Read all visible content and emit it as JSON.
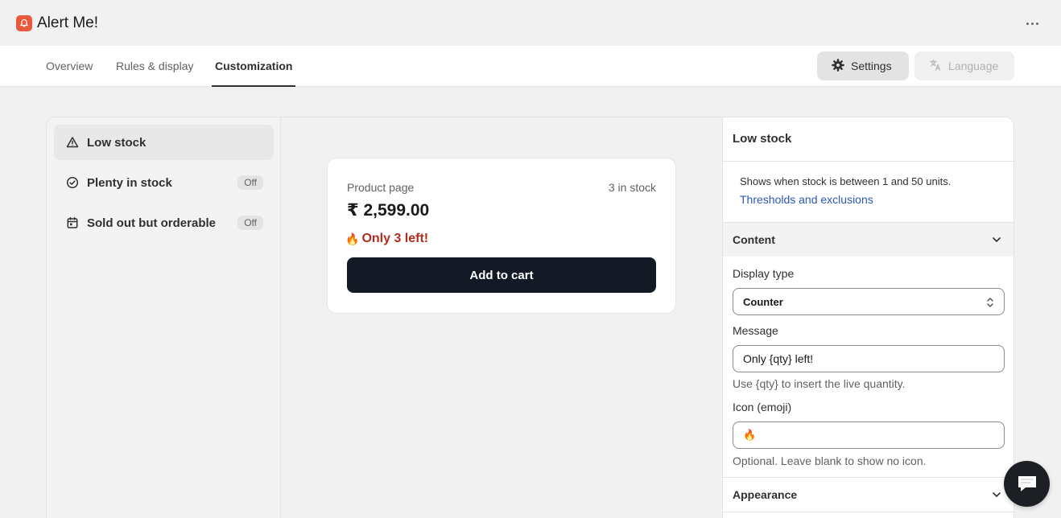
{
  "app": {
    "title": "Alert Me!",
    "accent_color": "#e8583a",
    "logo_icon": "bell-icon",
    "more_icon": "more-horizontal-icon"
  },
  "tabs": [
    {
      "label": "Overview",
      "active": false
    },
    {
      "label": "Rules & display",
      "active": false
    },
    {
      "label": "Customization",
      "active": true
    }
  ],
  "header_actions": {
    "settings_label": "Settings",
    "settings_icon": "gear-icon",
    "language_label": "Language",
    "language_icon": "translate-icon",
    "language_disabled": true
  },
  "alert_types": [
    {
      "label": "Low stock",
      "icon": "warning-triangle-icon",
      "active": true,
      "badge": ""
    },
    {
      "label": "Plenty in stock",
      "icon": "check-circle-icon",
      "active": false,
      "badge": "Off"
    },
    {
      "label": "Sold out but orderable",
      "icon": "calendar-icon",
      "active": false,
      "badge": "Off"
    }
  ],
  "preview": {
    "label": "Product page",
    "stock": "3 in stock",
    "price": "₹ 2,599.00",
    "alert_icon": "🔥",
    "alert_text": "Only 3 left!",
    "alert_color": "#b52b1c",
    "button_label": "Add to cart",
    "button_color": "#141a25"
  },
  "settings": {
    "title": "Low stock",
    "description": "Shows when stock is between 1 and 50 units.",
    "link": "Thresholds and exclusions",
    "content_section": {
      "title": "Content",
      "expanded": true,
      "display_type_label": "Display type",
      "display_type_value": "Counter",
      "message_label": "Message",
      "message_value": "Only {qty} left!",
      "message_help": "Use {qty} to insert the live quantity.",
      "icon_label": "Icon (emoji)",
      "icon_value": "🔥",
      "icon_help": "Optional. Leave blank to show no icon."
    },
    "appearance_section": {
      "title": "Appearance",
      "expanded": false
    }
  },
  "chat_icon": "chat-bubble-icon"
}
